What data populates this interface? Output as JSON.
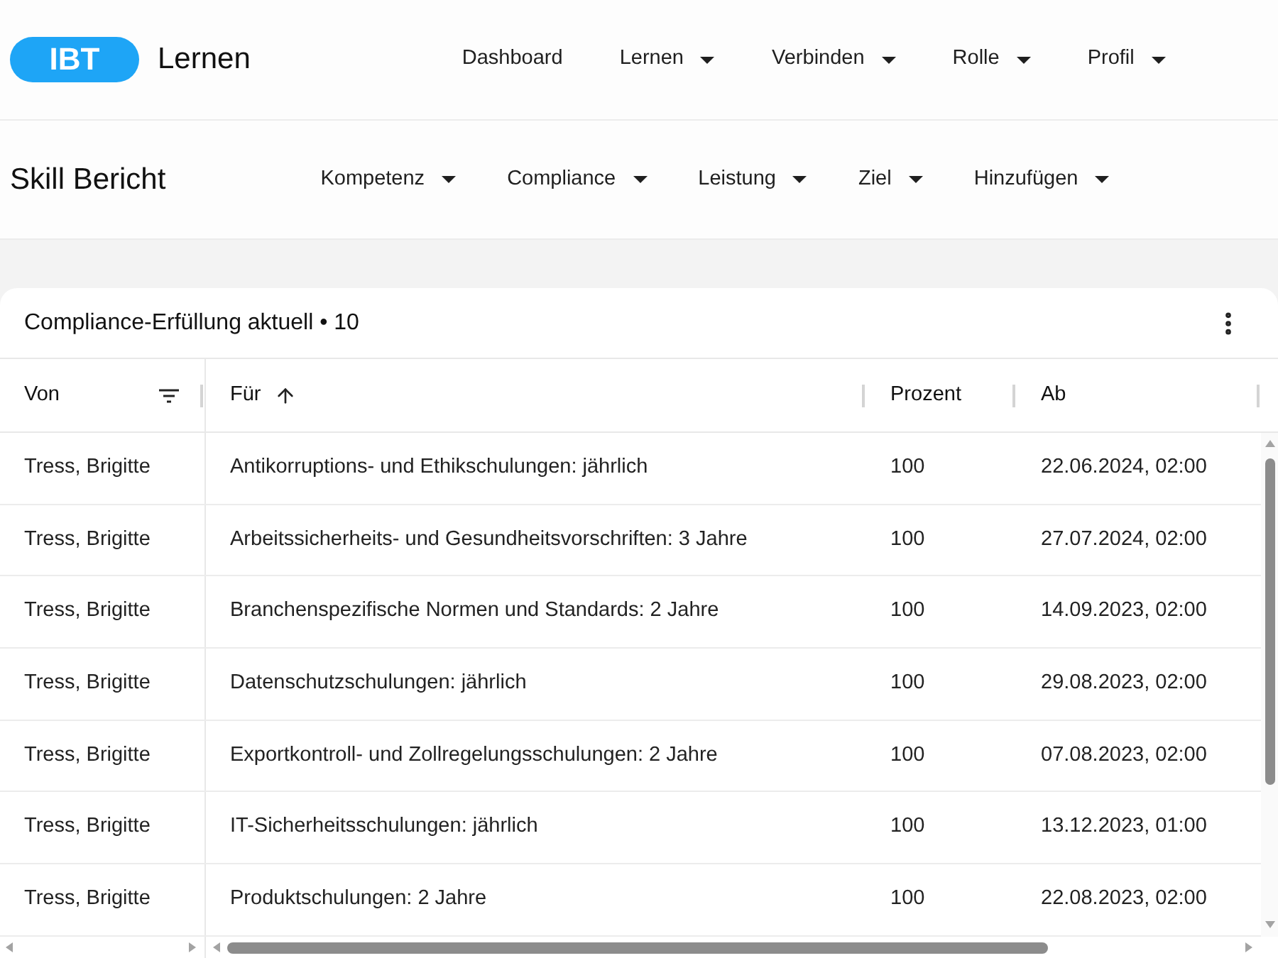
{
  "header": {
    "logo": "IBT",
    "title": "Lernen"
  },
  "nav": [
    {
      "label": "Dashboard",
      "kind": "link"
    },
    {
      "label": "Lernen",
      "kind": "menu"
    },
    {
      "label": "Verbinden",
      "kind": "menu"
    },
    {
      "label": "Rolle",
      "kind": "menu"
    },
    {
      "label": "Profil",
      "kind": "menu"
    }
  ],
  "page": {
    "title": "Skill Bericht",
    "menus": [
      "Kompetenz",
      "Compliance",
      "Leistung",
      "Ziel",
      "Hinzufügen"
    ]
  },
  "card": {
    "title": "Compliance-Erfüllung aktuell • 10"
  },
  "table": {
    "columns": [
      {
        "label": "Von",
        "filter": true,
        "sorted": false
      },
      {
        "label": "Für",
        "filter": false,
        "sorted": true
      },
      {
        "label": "Prozent",
        "filter": false,
        "sorted": false
      },
      {
        "label": "Ab",
        "filter": false,
        "sorted": false
      }
    ],
    "rows": [
      [
        "Tress, Brigitte",
        "Antikorruptions- und Ethikschulungen: jährlich",
        "100",
        "22.06.2024, 02:00"
      ],
      [
        "Tress, Brigitte",
        "Arbeitssicherheits- und Gesundheitsvorschriften: 3 Jahre",
        "100",
        "27.07.2024, 02:00"
      ],
      [
        "Tress, Brigitte",
        "Branchenspezifische Normen und Standards: 2 Jahre",
        "100",
        "14.09.2023, 02:00"
      ],
      [
        "Tress, Brigitte",
        "Datenschutzschulungen: jährlich",
        "100",
        "29.08.2023, 02:00"
      ],
      [
        "Tress, Brigitte",
        "Exportkontroll- und Zollregelungsschulungen: 2 Jahre",
        "100",
        "07.08.2023, 02:00"
      ],
      [
        "Tress, Brigitte",
        "IT-Sicherheitsschulungen: jährlich",
        "100",
        "13.12.2023, 01:00"
      ],
      [
        "Tress, Brigitte",
        "Produktschulungen: 2 Jahre",
        "100",
        "22.08.2023, 02:00"
      ]
    ]
  }
}
